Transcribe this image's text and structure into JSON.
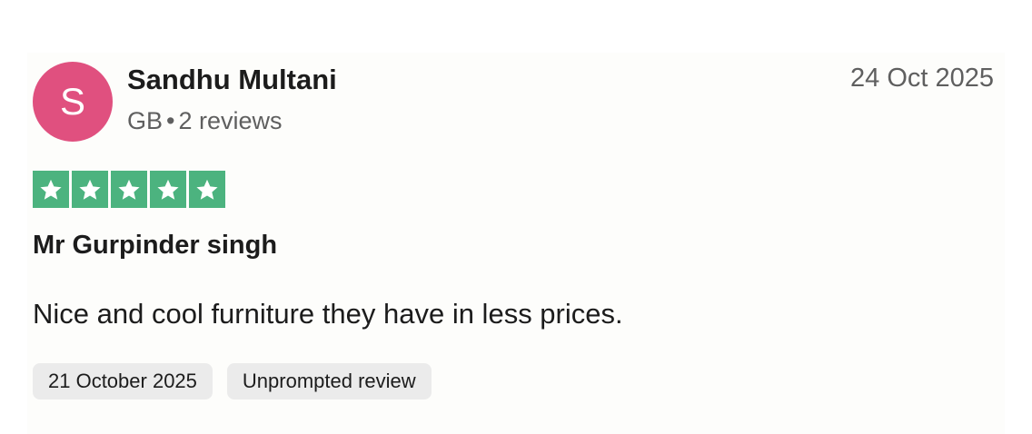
{
  "reviewer": {
    "initial": "S",
    "name": "Sandhu Multani",
    "country": "GB",
    "separator": "•",
    "review_count": "2 reviews",
    "avatar_color": "#e0507f"
  },
  "review": {
    "posted_date": "24 Oct 2025",
    "rating": 5,
    "rating_max": 5,
    "star_color": "#4cb37f",
    "title": "Mr Gurpinder singh",
    "body": "Nice and cool furniture they have in less prices.",
    "experience_date": "21 October 2025",
    "label": "Unprompted review"
  }
}
